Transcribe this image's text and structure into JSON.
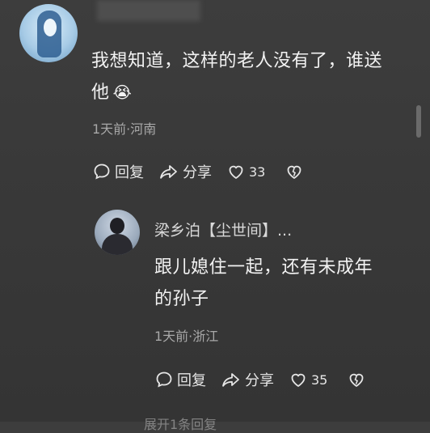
{
  "comment": {
    "username_hidden": "",
    "text_line1": "我想知道，这样的老人没有了，谁送",
    "text_line2": "他",
    "emoji": "😭",
    "meta": "1天前·河南",
    "actions": {
      "reply": "回复",
      "share": "分享",
      "likes": "33"
    }
  },
  "reply": {
    "username": "梁乡泊【尘世间】...",
    "text_line1": "跟儿媳住一起，还有未成年",
    "text_line2": "的孙子",
    "meta": "1天前·浙江",
    "actions": {
      "reply": "回复",
      "share": "分享",
      "likes": "35"
    }
  },
  "bottom_partial": "展开1条回复",
  "colors": {
    "background": "#393939",
    "text": "#f2f2f2",
    "meta": "#a8a8a8"
  },
  "icons": [
    "comment-bubble-icon",
    "share-arrow-icon",
    "heart-icon",
    "broken-heart-icon"
  ]
}
